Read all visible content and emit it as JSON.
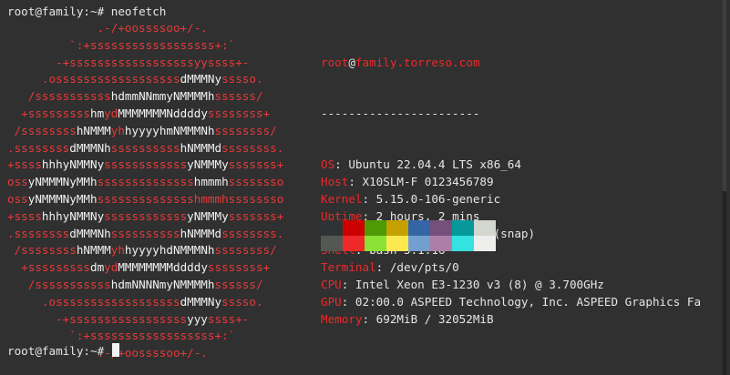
{
  "terminal": {
    "command_prompt": "root@family:~# ",
    "command": "neofetch",
    "final_prompt": "root@family:~# "
  },
  "logo_lines": [
    [
      [
        "r",
        "             .-/+oossssoo+/-."
      ]
    ],
    [
      [
        "r",
        "         `:+ssssssssssssssssss+:`"
      ]
    ],
    [
      [
        "r",
        "       -+ssssssssssssssssssyyssss+-"
      ]
    ],
    [
      [
        "r",
        "     .ossssssssssssssssss"
      ],
      [
        "w",
        "dMMMNy"
      ],
      [
        "r",
        "sssso."
      ]
    ],
    [
      [
        "r",
        "   /sssssssssss"
      ],
      [
        "w",
        "hdmmNNmmyNMMMMh"
      ],
      [
        "r",
        "ssssss/"
      ]
    ],
    [
      [
        "r",
        "  +sssssssss"
      ],
      [
        "w",
        "hm"
      ],
      [
        "r",
        "yd"
      ],
      [
        "w",
        "MMMMMMMNddddy"
      ],
      [
        "r",
        "ssssssss+"
      ]
    ],
    [
      [
        "r",
        " /ssssssss"
      ],
      [
        "w",
        "hNMMM"
      ],
      [
        "r",
        "yh"
      ],
      [
        "w",
        "hyyyyhmNMMMNh"
      ],
      [
        "r",
        "ssssssss/"
      ]
    ],
    [
      [
        "r",
        ".ssssssss"
      ],
      [
        "w",
        "dMMMNh"
      ],
      [
        "r",
        "ssssssssss"
      ],
      [
        "w",
        "hNMMMd"
      ],
      [
        "r",
        "ssssssss."
      ]
    ],
    [
      [
        "r",
        "+ssss"
      ],
      [
        "w",
        "hhhyNMMNy"
      ],
      [
        "r",
        "ssssssssssss"
      ],
      [
        "w",
        "yNMMMy"
      ],
      [
        "r",
        "sssssss+"
      ]
    ],
    [
      [
        "r",
        "oss"
      ],
      [
        "w",
        "yNMMMNyMMh"
      ],
      [
        "r",
        "ssssssssssssss"
      ],
      [
        "w",
        "hmmmh"
      ],
      [
        "r",
        "ssssssso"
      ]
    ],
    [
      [
        "r",
        "oss"
      ],
      [
        "w",
        "yNMMMNyMMh"
      ],
      [
        "r",
        "sssssssssssssshmmmhssssssso"
      ]
    ],
    [
      [
        "r",
        "+ssss"
      ],
      [
        "w",
        "hhhyNMMNy"
      ],
      [
        "r",
        "ssssssssssss"
      ],
      [
        "w",
        "yNMMMy"
      ],
      [
        "r",
        "sssssss+"
      ]
    ],
    [
      [
        "r",
        ".ssssssss"
      ],
      [
        "w",
        "dMMMNh"
      ],
      [
        "r",
        "ssssssssss"
      ],
      [
        "w",
        "hNMMMd"
      ],
      [
        "r",
        "ssssssss."
      ]
    ],
    [
      [
        "r",
        " /ssssssss"
      ],
      [
        "w",
        "hNMMM"
      ],
      [
        "r",
        "yh"
      ],
      [
        "w",
        "hyyyyhdNMMMNh"
      ],
      [
        "r",
        "ssssssss/"
      ]
    ],
    [
      [
        "r",
        "  +sssssssss"
      ],
      [
        "w",
        "dm"
      ],
      [
        "r",
        "yd"
      ],
      [
        "w",
        "MMMMMMMMddddy"
      ],
      [
        "r",
        "ssssssss+"
      ]
    ],
    [
      [
        "r",
        "   /sssssssssss"
      ],
      [
        "w",
        "hdmNNNNmyNMMMMh"
      ],
      [
        "r",
        "ssssss/"
      ]
    ],
    [
      [
        "r",
        "     .ossssssssssssssssss"
      ],
      [
        "w",
        "dMMMNy"
      ],
      [
        "r",
        "sssso."
      ]
    ],
    [
      [
        "r",
        "       -+sssssssssssssssss"
      ],
      [
        "w",
        "yyy"
      ],
      [
        "r",
        "ssss+-"
      ]
    ],
    [
      [
        "r",
        "         `:+ssssssssssssssssss+:`"
      ]
    ],
    [
      [
        "r",
        "             .-/+oossssoo+/-."
      ]
    ]
  ],
  "info": {
    "user": "root",
    "at": "@",
    "host": "family.torreso.com",
    "separator": "-----------------------",
    "rows": [
      {
        "key": "OS",
        "value": "Ubuntu 22.04.4 LTS x86_64"
      },
      {
        "key": "Host",
        "value": "X10SLM-F 0123456789"
      },
      {
        "key": "Kernel",
        "value": "5.15.0-106-generic"
      },
      {
        "key": "Uptime",
        "value": "2 hours, 2 mins"
      },
      {
        "key": "Packages",
        "value": "1076 (dpkg), 7 (snap)"
      },
      {
        "key": "Shell",
        "value": "bash 5.1.16"
      },
      {
        "key": "Terminal",
        "value": "/dev/pts/0"
      },
      {
        "key": "CPU",
        "value": "Intel Xeon E3-1230 v3 (8) @ 3.700GHz"
      },
      {
        "key": "GPU",
        "value": "02:00.0 ASPEED Technology, Inc. ASPEED Graphics Fa"
      },
      {
        "key": "Memory",
        "value": "692MiB / 32052MiB"
      }
    ]
  },
  "palette": {
    "row1": [
      "#2e3436",
      "#cc0000",
      "#4e9a06",
      "#c4a000",
      "#3465a4",
      "#75507b",
      "#06989a",
      "#d3d7cf"
    ],
    "row2": [
      "#555753",
      "#ef2929",
      "#8ae234",
      "#fce94f",
      "#729fcf",
      "#ad7fa8",
      "#34e2e2",
      "#eeeeec"
    ]
  },
  "colors": {
    "background": "#303030",
    "accent_red": "#ef2929",
    "logo_red": "#e63a3a",
    "text": "#e6e6e6"
  }
}
